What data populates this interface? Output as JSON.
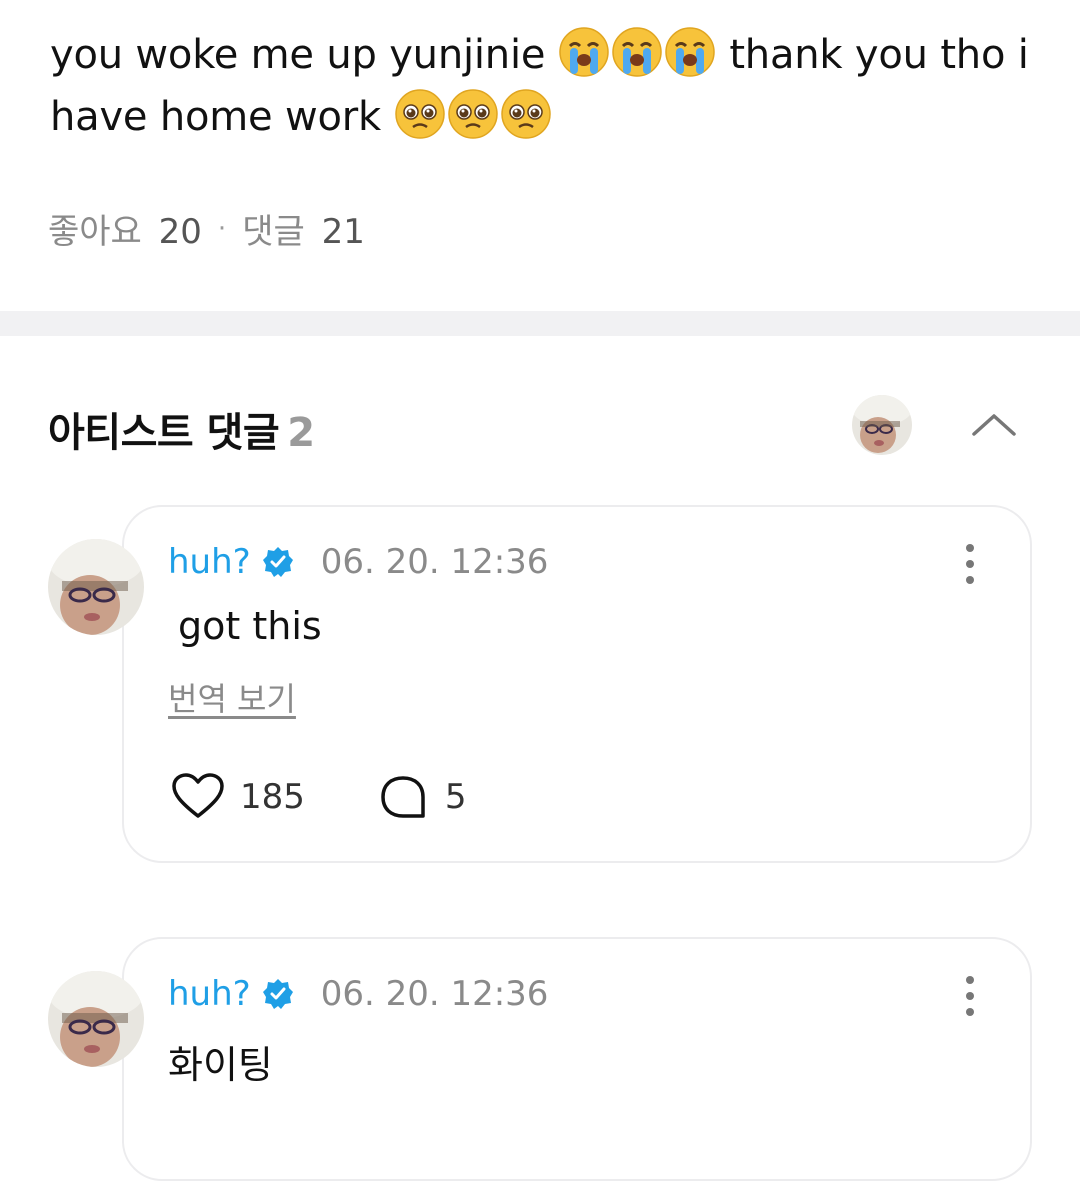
{
  "post": {
    "text_line1_a": "you woke me up yunjinie",
    "text_line1_b": "thank you tho i",
    "text_line2": "have home work",
    "emojis_crying": [
      "loudly-crying-face",
      "loudly-crying-face",
      "loudly-crying-face"
    ],
    "emojis_pleading": [
      "pleading-face",
      "pleading-face",
      "pleading-face"
    ]
  },
  "stats": {
    "likes_label": "좋아요",
    "likes_count": "20",
    "separator": "·",
    "comments_label": "댓글",
    "comments_count": "21"
  },
  "artist_comments": {
    "title": "아티스트 댓글",
    "count": "2",
    "collapse_icon": "chevron-up-icon"
  },
  "comments": [
    {
      "author": "huh?",
      "verified": true,
      "time": "06. 20. 12:36",
      "body": "got this",
      "translate_label": "번역 보기",
      "likes": "185",
      "replies": "5"
    },
    {
      "author": "huh?",
      "verified": true,
      "time": "06. 20. 12:36",
      "body": "화이팅"
    }
  ],
  "colors": {
    "accent_name": "#1f9fe6",
    "muted_text": "#8a8a8a",
    "divider": "#f1f1f3",
    "card_border": "#ececee"
  }
}
